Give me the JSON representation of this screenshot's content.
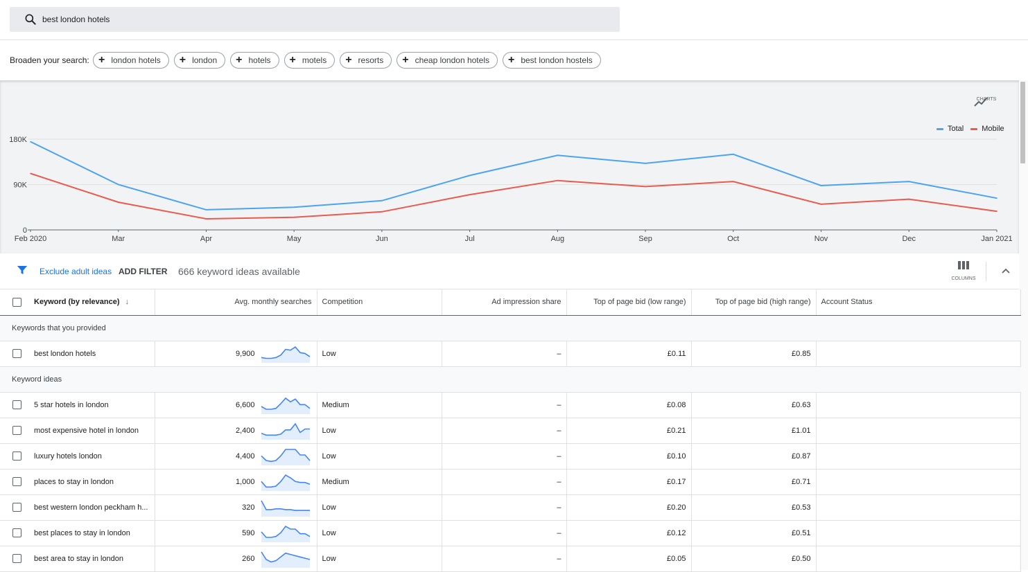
{
  "search": {
    "query": "best london hotels"
  },
  "broaden": {
    "label": "Broaden your search:",
    "chips": [
      "london hotels",
      "london",
      "hotels",
      "motels",
      "resorts",
      "cheap london hotels",
      "best london hostels"
    ]
  },
  "chart_toolbar": {
    "charts_label": "CHARTS"
  },
  "chart_data": {
    "type": "line",
    "x": [
      "Feb 2020",
      "Mar",
      "Apr",
      "May",
      "Jun",
      "Jul",
      "Aug",
      "Sep",
      "Oct",
      "Nov",
      "Dec",
      "Jan 2021"
    ],
    "series": [
      {
        "name": "Total",
        "color": "#4da3f0",
        "values": [
          175000,
          90000,
          40000,
          45000,
          58000,
          108000,
          148000,
          132000,
          150000,
          88000,
          96000,
          63000
        ]
      },
      {
        "name": "Mobile",
        "color": "#ea5a4f",
        "values": [
          112000,
          55000,
          22000,
          25000,
          36000,
          70000,
          98000,
          86000,
          96000,
          51000,
          61000,
          37000
        ]
      }
    ],
    "y_ticks": [
      "0",
      "90K",
      "180K"
    ],
    "ylim": [
      0,
      180000
    ],
    "grid": true,
    "legend": "top-right"
  },
  "filters": {
    "exclude_label": "Exclude adult ideas",
    "add_filter_label": "ADD FILTER",
    "available_text": "666 keyword ideas available",
    "columns_label": "COLUMNS"
  },
  "table": {
    "headers": {
      "keyword": "Keyword (by relevance)",
      "searches": "Avg. monthly searches",
      "competition": "Competition",
      "impression": "Ad impression share",
      "low_bid": "Top of page bid (low range)",
      "high_bid": "Top of page bid (high range)",
      "status": "Account Status"
    },
    "provided_group": "Keywords that you provided",
    "ideas_group": "Keyword ideas",
    "provided": [
      {
        "keyword": "best london hotels",
        "searches": "9,900",
        "competition": "Low",
        "impression": "–",
        "low": "£0.11",
        "high": "£0.85",
        "trend": [
          4,
          3,
          3,
          4,
          7,
          14,
          13,
          17,
          10,
          9,
          5
        ]
      }
    ],
    "ideas": [
      {
        "keyword": "5 star hotels in london",
        "searches": "6,600",
        "competition": "Medium",
        "impression": "–",
        "low": "£0.08",
        "high": "£0.63",
        "trend": [
          6,
          3,
          3,
          4,
          9,
          15,
          11,
          14,
          8,
          8,
          4
        ]
      },
      {
        "keyword": "most expensive hotel in london",
        "searches": "2,400",
        "competition": "Low",
        "impression": "–",
        "low": "£0.21",
        "high": "£1.01",
        "trend": [
          5,
          3,
          3,
          3,
          4,
          9,
          9,
          16,
          6,
          10,
          10
        ]
      },
      {
        "keyword": "luxury hotels london",
        "searches": "4,400",
        "competition": "Low",
        "impression": "–",
        "low": "£0.10",
        "high": "£0.87",
        "trend": [
          8,
          3,
          2,
          3,
          8,
          15,
          15,
          15,
          9,
          9,
          3
        ]
      },
      {
        "keyword": "places to stay in london",
        "searches": "1,000",
        "competition": "Medium",
        "impression": "–",
        "low": "£0.17",
        "high": "£0.71",
        "trend": [
          8,
          2,
          2,
          3,
          8,
          15,
          12,
          8,
          7,
          7,
          5
        ]
      },
      {
        "keyword": "best western london peckham h...",
        "searches": "320",
        "competition": "Low",
        "impression": "–",
        "low": "£0.20",
        "high": "£0.53",
        "trend": [
          17,
          6,
          6,
          7,
          7,
          6,
          6,
          5,
          5,
          5,
          5
        ]
      },
      {
        "keyword": "best places to stay in london",
        "searches": "590",
        "competition": "Low",
        "impression": "–",
        "low": "£0.12",
        "high": "£0.51",
        "trend": [
          9,
          3,
          3,
          4,
          8,
          15,
          12,
          12,
          7,
          7,
          4
        ]
      },
      {
        "keyword": "best area to stay in london",
        "searches": "260",
        "competition": "Low",
        "impression": "–",
        "low": "£0.05",
        "high": "£0.50",
        "trend": [
          11,
          5,
          3,
          4,
          7,
          10,
          9,
          8,
          7,
          6,
          5
        ]
      }
    ]
  }
}
